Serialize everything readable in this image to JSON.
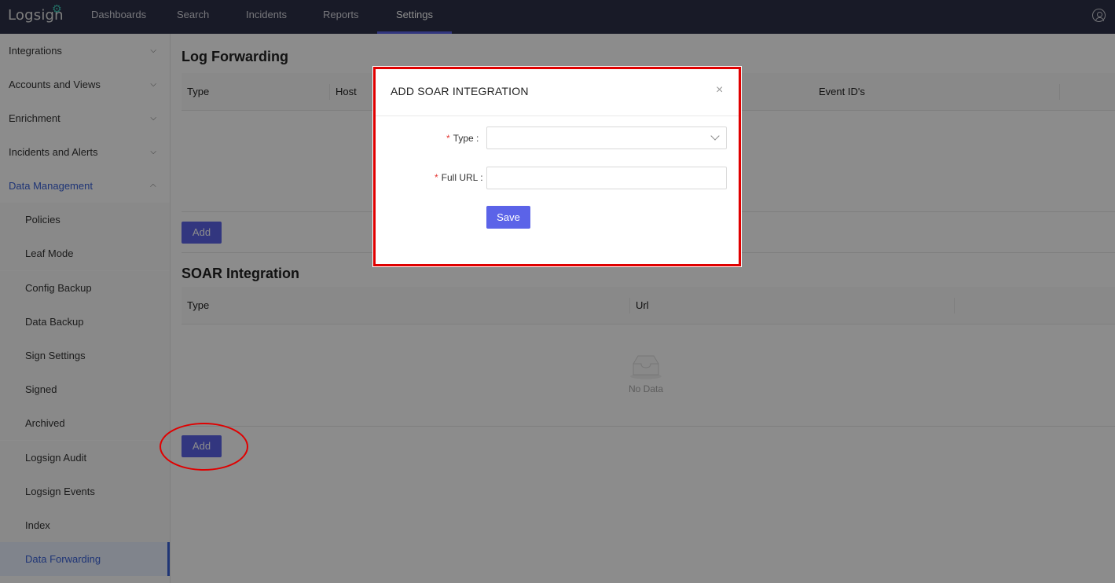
{
  "topnav": {
    "logo": "Logsign",
    "items": [
      {
        "label": "Dashboards"
      },
      {
        "label": "Search"
      },
      {
        "label": "Incidents"
      },
      {
        "label": "Reports"
      },
      {
        "label": "Settings",
        "active": true
      }
    ]
  },
  "sidebar": {
    "groups": [
      {
        "label": "Integrations"
      },
      {
        "label": "Accounts and Views"
      },
      {
        "label": "Enrichment"
      },
      {
        "label": "Incidents and Alerts"
      },
      {
        "label": "Data Management",
        "open": true
      }
    ],
    "sub_items": [
      {
        "label": "Policies"
      },
      {
        "label": "Leaf Mode"
      },
      {
        "label": "Config Backup"
      },
      {
        "label": "Data Backup"
      },
      {
        "label": "Sign Settings"
      },
      {
        "label": "Signed"
      },
      {
        "label": "Archived"
      },
      {
        "label": "Logsign Audit"
      },
      {
        "label": "Logsign Events"
      },
      {
        "label": "Index"
      },
      {
        "label": "Data Forwarding",
        "selected": true
      }
    ]
  },
  "log_forwarding": {
    "title": "Log Forwarding",
    "columns": [
      "Type",
      "Host",
      "Event ID's"
    ],
    "add_label": "Add"
  },
  "soar_integration": {
    "title": "SOAR Integration",
    "columns": [
      "Type",
      "Url"
    ],
    "empty_text": "No Data",
    "add_label": "Add"
  },
  "modal": {
    "title": "ADD SOAR INTEGRATION",
    "close_glyph": "×",
    "required_mark": "*",
    "type_label": "Type :",
    "type_value": "",
    "url_label": "Full URL :",
    "url_value": "",
    "save_label": "Save"
  },
  "colors": {
    "topbar": "#2d3147",
    "accent": "#5b63e8",
    "annotation": "#e00000"
  }
}
